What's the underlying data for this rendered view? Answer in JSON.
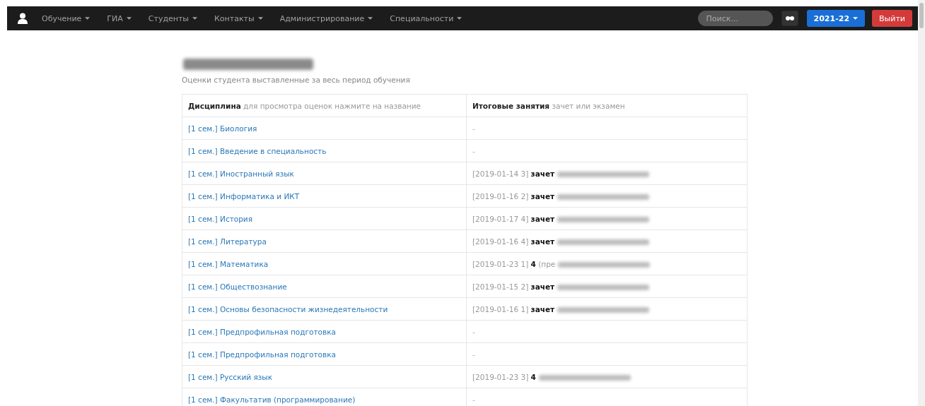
{
  "navbar": {
    "menus": [
      {
        "label": "Обучение"
      },
      {
        "label": "ГИА"
      },
      {
        "label": "Студенты"
      },
      {
        "label": "Контакты"
      },
      {
        "label": "Администрирование"
      },
      {
        "label": "Специальности"
      }
    ],
    "search": {
      "placeholder": "Поиск..."
    },
    "year_button": {
      "label": "2021-22"
    },
    "logout_button": {
      "label": "Выйти"
    }
  },
  "student": {
    "name_redacted": true,
    "subtitle": "Оценки студента выставленные за весь период обучения"
  },
  "table": {
    "columns": [
      {
        "title": "Дисциплина",
        "hint": "для просмотра оценок нажмите на название"
      },
      {
        "title": "Итоговые занятия",
        "hint": "зачет или экзамен"
      }
    ],
    "rows": [
      {
        "discipline": "[1 сем.] Биология",
        "result": "-"
      },
      {
        "discipline": "[1 сем.] Введение в специальность",
        "result": "-"
      },
      {
        "discipline": "[1 сем.] Иностранный язык",
        "date": "[2019-01-14 3]",
        "grade": "зачет",
        "redacted": true
      },
      {
        "discipline": "[1 сем.] Информатика и ИКТ",
        "date": "[2019-01-16 2]",
        "grade": "зачет",
        "redacted": true
      },
      {
        "discipline": "[1 сем.] История",
        "date": "[2019-01-17 4]",
        "grade": "зачет",
        "redacted": true
      },
      {
        "discipline": "[1 сем.] Литература",
        "date": "[2019-01-16 4]",
        "grade": "зачет",
        "redacted": true
      },
      {
        "discipline": "[1 сем.] Математика",
        "date": "[2019-01-23 1]",
        "grade": "4",
        "note": "(пре",
        "redacted": true
      },
      {
        "discipline": "[1 сем.] Обществознание",
        "date": "[2019-01-15 2]",
        "grade": "зачет",
        "redacted": true
      },
      {
        "discipline": "[1 сем.] Основы безопасности жизнедеятельности",
        "date": "[2019-01-16 1]",
        "grade": "зачет",
        "redacted": true
      },
      {
        "discipline": "[1 сем.] Предпрофильная подготовка",
        "result": "-"
      },
      {
        "discipline": "[1 сем.] Предпрофильная подготовка",
        "result": "-"
      },
      {
        "discipline": "[1 сем.] Русский язык",
        "date": "[2019-01-23 3]",
        "grade": "4",
        "redacted": true
      },
      {
        "discipline": "[1 сем.] Факультатив (программирование)",
        "result": "-"
      }
    ]
  }
}
